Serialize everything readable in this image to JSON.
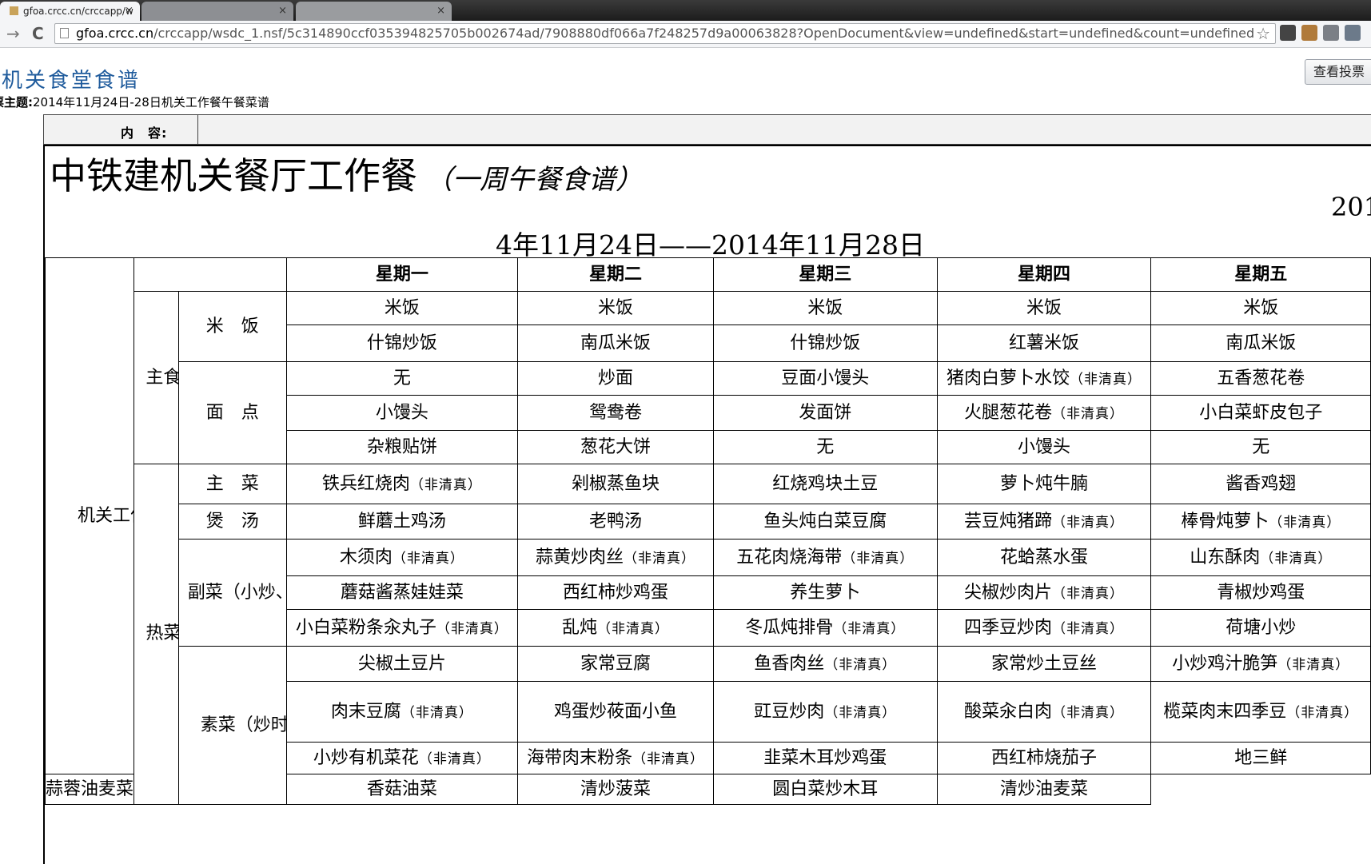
{
  "browser": {
    "tabs": [
      {
        "title": "gfoa.crcc.cn/crccapp/w",
        "close": "×"
      },
      {
        "title": "",
        "close": "×"
      },
      {
        "title": "",
        "close": "×"
      }
    ],
    "url_host": "gfoa.crcc.cn",
    "url_path": "/crccapp/wsdc_1.nsf/5c314890ccf035394825705b002674ad/7908880df066a7f248257d9a00063828?OpenDocument&view=undefined&start=undefined&count=undefined",
    "back": "→",
    "reload": "C",
    "star": "☆",
    "extensions": [
      {
        "icon": "otx-icon",
        "color": "#444444"
      },
      {
        "icon": "ext-icon",
        "color": "#b07a3a"
      },
      {
        "icon": "page-icon",
        "color": "#7b7f86"
      },
      {
        "icon": "ip-icon",
        "color": "#6c7a8a"
      }
    ]
  },
  "header": {
    "title": "机关食堂食谱",
    "view_votes_button": "查看投票",
    "subject_label": "票主题:",
    "subject_value": "2014年11月24日-28日机关工作餐午餐菜谱",
    "content_label": "内　容:"
  },
  "doc": {
    "headline": "中铁建机关餐厅工作餐",
    "headline_sub": "（一周午餐食谱）",
    "year_fragment": "201",
    "date_range": "4年11月24日——2014年11月28日"
  },
  "table": {
    "section_label": "机关工作餐",
    "groups": {
      "staple": "主食",
      "hot": "热菜"
    },
    "categories": {
      "rice": "米　饭",
      "noodle": "面　点",
      "main": "主　菜",
      "soup": "煲　汤",
      "side": "副菜（小炒、辣菜、炖菜）",
      "veg": "素菜（炒时蔬）"
    },
    "days": [
      "星期一",
      "星期二",
      "星期三",
      "星期四",
      "星期五"
    ],
    "tag": "（非清真）",
    "rows": [
      [
        {
          "t": "米饭"
        },
        {
          "t": "米饭"
        },
        {
          "t": "米饭"
        },
        {
          "t": "米饭"
        },
        {
          "t": "米饭"
        }
      ],
      [
        {
          "t": "什锦炒饭"
        },
        {
          "t": "南瓜米饭"
        },
        {
          "t": "什锦炒饭"
        },
        {
          "t": "红薯米饭"
        },
        {
          "t": "南瓜米饭"
        }
      ],
      [
        {
          "t": "无"
        },
        {
          "t": "炒面"
        },
        {
          "t": "豆面小馒头"
        },
        {
          "t": "猪肉白萝卜水饺",
          "tag": true
        },
        {
          "t": "五香葱花卷"
        }
      ],
      [
        {
          "t": "小馒头"
        },
        {
          "t": "鸳鸯卷"
        },
        {
          "t": "发面饼"
        },
        {
          "t": "火腿葱花卷",
          "tag": true
        },
        {
          "t": "小白菜虾皮包子"
        }
      ],
      [
        {
          "t": "杂粮贴饼"
        },
        {
          "t": "葱花大饼"
        },
        {
          "t": "无"
        },
        {
          "t": "小馒头"
        },
        {
          "t": "无"
        }
      ],
      [
        {
          "t": "铁兵红烧肉",
          "tag": true
        },
        {
          "t": "剁椒蒸鱼块"
        },
        {
          "t": "红烧鸡块土豆"
        },
        {
          "t": "萝卜炖牛腩"
        },
        {
          "t": "酱香鸡翅"
        }
      ],
      [
        {
          "t": "鲜蘑土鸡汤"
        },
        {
          "t": "老鸭汤"
        },
        {
          "t": "鱼头炖白菜豆腐"
        },
        {
          "t": "芸豆炖猪蹄",
          "tag": true
        },
        {
          "t": "棒骨炖萝卜",
          "tag": true
        }
      ],
      [
        {
          "t": "木须肉",
          "tag": true
        },
        {
          "t": "蒜黄炒肉丝",
          "tag": true
        },
        {
          "t": "五花肉烧海带",
          "tag": true
        },
        {
          "t": "花蛤蒸水蛋"
        },
        {
          "t": "山东酥肉",
          "tag": true
        }
      ],
      [
        {
          "t": "蘑菇酱蒸娃娃菜"
        },
        {
          "t": "西红柿炒鸡蛋"
        },
        {
          "t": "养生萝卜"
        },
        {
          "t": "尖椒炒肉片",
          "tag": true
        },
        {
          "t": "青椒炒鸡蛋"
        }
      ],
      [
        {
          "t": "小白菜粉条汆丸子",
          "tag": true
        },
        {
          "t": "乱炖",
          "tag": true
        },
        {
          "t": "冬瓜炖排骨",
          "tag": true
        },
        {
          "t": "四季豆炒肉",
          "tag": true
        },
        {
          "t": "荷塘小炒"
        }
      ],
      [
        {
          "t": "尖椒土豆片"
        },
        {
          "t": "家常豆腐",
          "big": true
        },
        {
          "t": "鱼香肉丝",
          "tag": true
        },
        {
          "t": "家常炒土豆丝"
        },
        {
          "t": "小炒鸡汁脆笋",
          "tag": true
        }
      ],
      [
        {
          "t": "肉末豆腐",
          "tag": true
        },
        {
          "t": "鸡蛋炒莜面小鱼",
          "big": true
        },
        {
          "t": "豇豆炒肉",
          "tag": true
        },
        {
          "t": "酸菜汆白肉",
          "tag": true
        },
        {
          "t": "榄菜肉末四季豆",
          "tag": true
        }
      ],
      [
        {
          "t": "小炒有机菜花",
          "tag": true
        },
        {
          "t": "海带肉末粉条",
          "tag": true
        },
        {
          "t": "韭菜木耳炒鸡蛋"
        },
        {
          "t": "西红柿烧茄子"
        },
        {
          "t": "地三鲜"
        }
      ],
      [
        {
          "t": "蒜蓉油麦菜"
        },
        {
          "t": "香菇油菜"
        },
        {
          "t": "清炒菠菜"
        },
        {
          "t": "圆白菜炒木耳"
        },
        {
          "t": "清炒油麦菜"
        }
      ]
    ]
  }
}
